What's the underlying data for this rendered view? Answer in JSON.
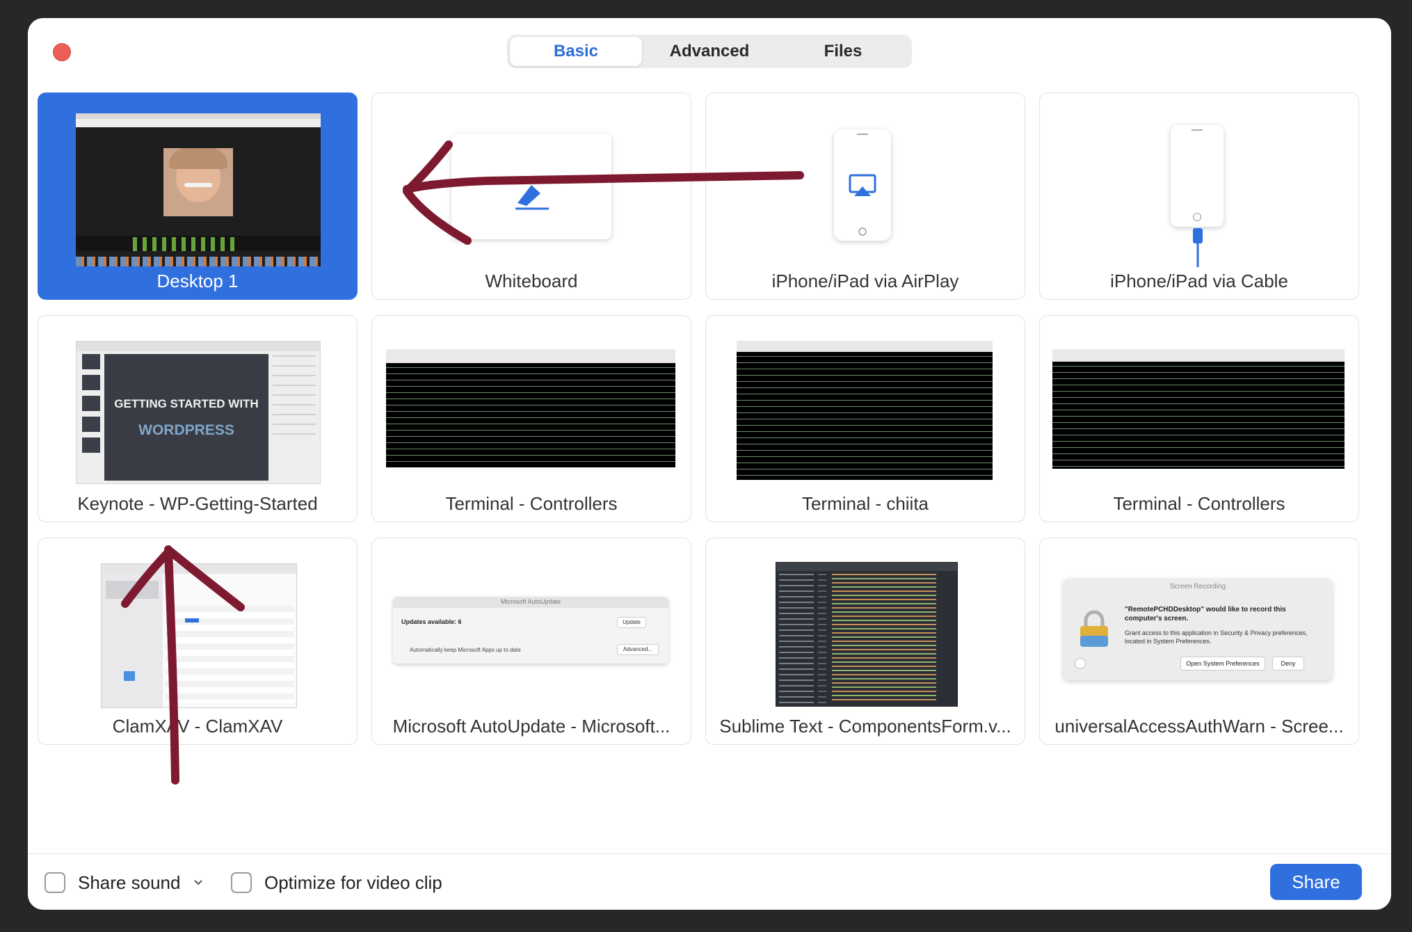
{
  "tabs": [
    {
      "label": "Basic",
      "active": true
    },
    {
      "label": "Advanced",
      "active": false
    },
    {
      "label": "Files",
      "active": false
    }
  ],
  "cards": [
    {
      "label": "Desktop 1",
      "selected": true
    },
    {
      "label": "Whiteboard",
      "selected": false
    },
    {
      "label": "iPhone/iPad via AirPlay",
      "selected": false
    },
    {
      "label": "iPhone/iPad via Cable",
      "selected": false
    },
    {
      "label": "Keynote - WP-Getting-Started",
      "selected": false
    },
    {
      "label": "Terminal - Controllers",
      "selected": false
    },
    {
      "label": "Terminal - chiita",
      "selected": false
    },
    {
      "label": "Terminal - Controllers",
      "selected": false
    },
    {
      "label": "ClamXAV - ClamXAV",
      "selected": false
    },
    {
      "label": "Microsoft AutoUpdate - Microsoft...",
      "selected": false
    },
    {
      "label": "Sublime Text - ComponentsForm.v...",
      "selected": false
    },
    {
      "label": "universalAccessAuthWarn - Scree...",
      "selected": false
    }
  ],
  "thumbs": {
    "keynote_title_1": "GETTING STARTED WITH",
    "keynote_title_2": "WORDPRESS",
    "msau_title": "Microsoft AutoUpdate",
    "msau_updates": "Updates available: 6",
    "msau_update_btn": "Update",
    "msau_auto": "Automatically keep Microsoft Apps up to date",
    "msau_advanced": "Advanced...",
    "sr_title": "Screen Recording",
    "sr_heading": "\"RemotePCHDDesktop\" would like to record this computer's screen.",
    "sr_body": "Grant access to this application in Security & Privacy preferences, located in System Preferences.",
    "sr_open": "Open System Preferences",
    "sr_deny": "Deny"
  },
  "footer": {
    "share_sound": "Share sound",
    "optimize": "Optimize for video clip",
    "share_button": "Share"
  },
  "colors": {
    "accent": "#2f6fde",
    "annotation": "#7e1a30"
  }
}
